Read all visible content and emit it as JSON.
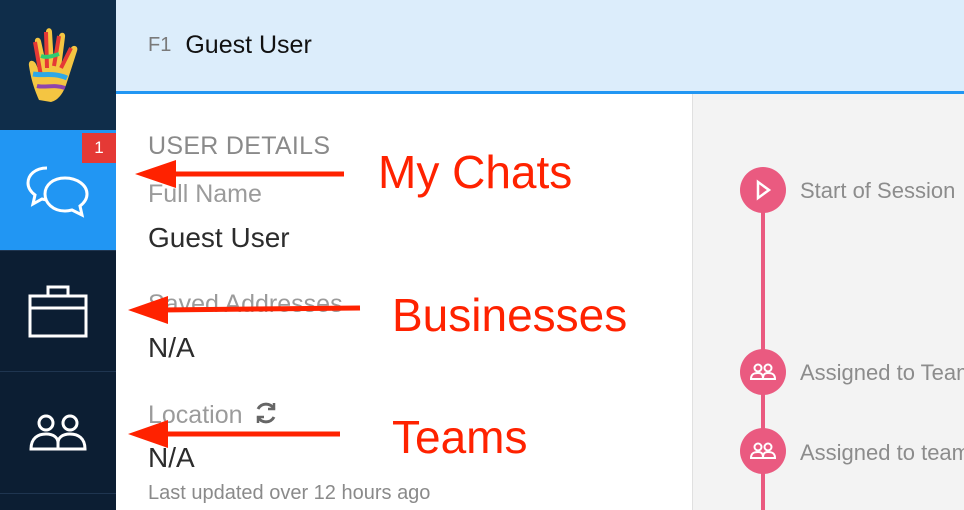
{
  "header": {
    "key": "F1",
    "title": "Guest User"
  },
  "sidebar": {
    "items": [
      {
        "id": "chats",
        "badge": "1"
      },
      {
        "id": "businesses"
      },
      {
        "id": "teams"
      }
    ]
  },
  "details": {
    "section_title": "USER DETAILS",
    "full_name_label": "Full Name",
    "full_name_value": "Guest User",
    "addresses_label": "Saved Addresses",
    "addresses_value": "N/A",
    "location_label": "Location",
    "location_value": "N/A",
    "location_updated": "Last updated over 12 hours ago"
  },
  "timeline": {
    "events": [
      {
        "label": "Start of Session",
        "icon": "play-icon"
      },
      {
        "label": "Assigned to Team",
        "icon": "team-icon"
      },
      {
        "label": "Assigned to team",
        "icon": "team-icon"
      }
    ]
  },
  "annotations": {
    "chats": "My Chats",
    "businesses": "Businesses",
    "teams": "Teams"
  },
  "colors": {
    "sidebar": "#0c1e33",
    "accent": "#2196f3",
    "badge": "#e53935",
    "timeline": "#ea5a80",
    "annotation": "#ff2200"
  }
}
